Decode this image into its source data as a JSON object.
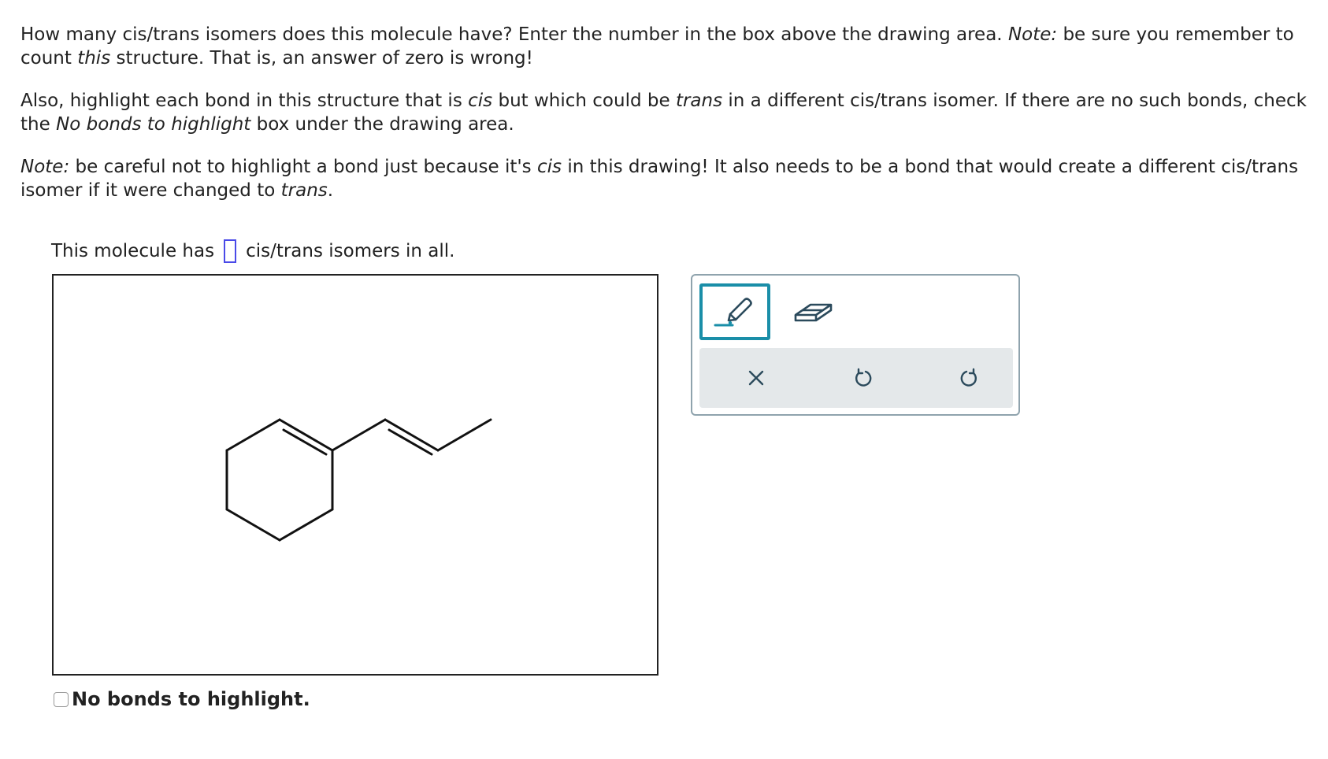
{
  "question": {
    "p1_a": "How many cis/trans isomers does this molecule have? Enter the number in the box above the drawing area. ",
    "p1_note": "Note:",
    "p1_b": " be sure you remember to count ",
    "p1_this": "this",
    "p1_c": " structure. That is, an answer of zero is wrong!",
    "p2_a": "Also, highlight each bond in this structure that is ",
    "p2_cis": "cis",
    "p2_b": " but which could be ",
    "p2_trans": "trans",
    "p2_c": " in a different cis/trans isomer. If there are no such bonds, check the ",
    "p2_nobonds": "No bonds to highlight",
    "p2_d": " box under the drawing area.",
    "p3_note": "Note:",
    "p3_a": " be careful not to highlight a bond just because it's ",
    "p3_cis": "cis",
    "p3_b": " in this drawing! It also needs to be a bond that would create a different cis/trans isomer if it were changed to ",
    "p3_trans": "trans",
    "p3_c": "."
  },
  "answer": {
    "prefix": "This molecule has",
    "value": "",
    "suffix": "cis/trans isomers in all."
  },
  "no_bonds_label": "No bonds to highlight.",
  "tools": {
    "highlight": "highlighter-icon",
    "eraser": "eraser-icon",
    "clear": "close-icon",
    "undo": "undo-icon",
    "redo": "redo-icon"
  },
  "colors": {
    "accent": "#1a8ea8",
    "answer_box": "#4a4ae8",
    "toolbox_border": "#8fa3ad",
    "action_bar": "#e4e8ea"
  }
}
